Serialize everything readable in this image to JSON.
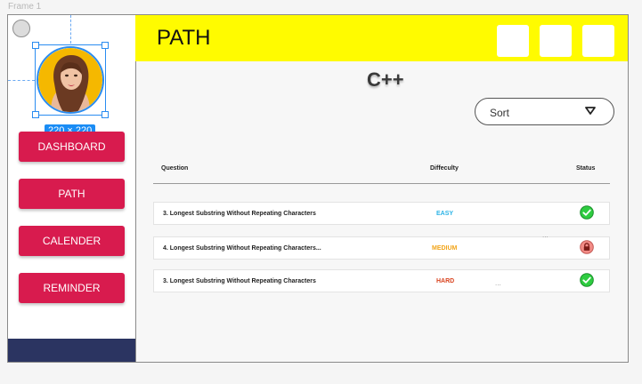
{
  "frame_label": "Frame 1",
  "sidebar": {
    "size_badge": "220 × 220",
    "nav": [
      {
        "label": "DASHBOARD"
      },
      {
        "label": "PATH"
      },
      {
        "label": "CALENDER"
      },
      {
        "label": "REMINDER"
      }
    ]
  },
  "header": {
    "title": "PATH"
  },
  "main": {
    "language": "C++",
    "sort_label": "Sort",
    "columns": {
      "question": "Question",
      "difficulty": "Diffeculty",
      "status": "Status"
    },
    "rows": [
      {
        "question": "3. Longest Substring Without Repeating Characters",
        "difficulty": "EASY",
        "difficulty_color": "#2bb3e6",
        "status_icon": "check-icon"
      },
      {
        "question": "4. Longest Substring Without Repeating Characters...",
        "difficulty": "MEDIUM",
        "difficulty_color": "#f2a51a",
        "status_icon": "lock-icon"
      },
      {
        "question": "3. Longest Substring Without Repeating Characters",
        "difficulty": "HARD",
        "difficulty_color": "#d9431e",
        "status_icon": "check-icon"
      }
    ],
    "ellipsis": "..."
  },
  "colors": {
    "accent_nav": "#d81b4e",
    "header_bg": "#fffb00",
    "sidebar_footer": "#2b3461",
    "check": "#2ecc40",
    "lock_bg": "#f28b86"
  }
}
